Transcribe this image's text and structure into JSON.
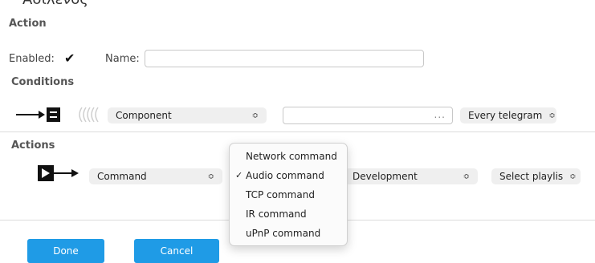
{
  "header": {
    "partial_title": "Ασίλενος"
  },
  "action": {
    "title": "Action",
    "enabled_label": "Enabled:",
    "enabled_check": "✔",
    "name_label": "Name:",
    "name_value": ""
  },
  "conditions": {
    "title": "Conditions",
    "source_select": "Component",
    "source_value": "",
    "source_ellipsis": "...",
    "frequency_select": "Every telegram"
  },
  "actions": {
    "title": "Actions",
    "type_select": "Command",
    "target_select": "Development",
    "playlist_select": "Select playlis"
  },
  "command_menu": {
    "items": [
      {
        "label": "Network command",
        "checked": false
      },
      {
        "label": "Audio command",
        "checked": true,
        "tick": "✓"
      },
      {
        "label": "TCP command",
        "checked": false
      },
      {
        "label": "IR command",
        "checked": false
      },
      {
        "label": "uPnP command",
        "checked": false
      }
    ]
  },
  "buttons": {
    "done": "Done",
    "cancel": "Cancel"
  },
  "colors": {
    "primary_button": "#1f9be6",
    "select_bg": "#efefef"
  }
}
